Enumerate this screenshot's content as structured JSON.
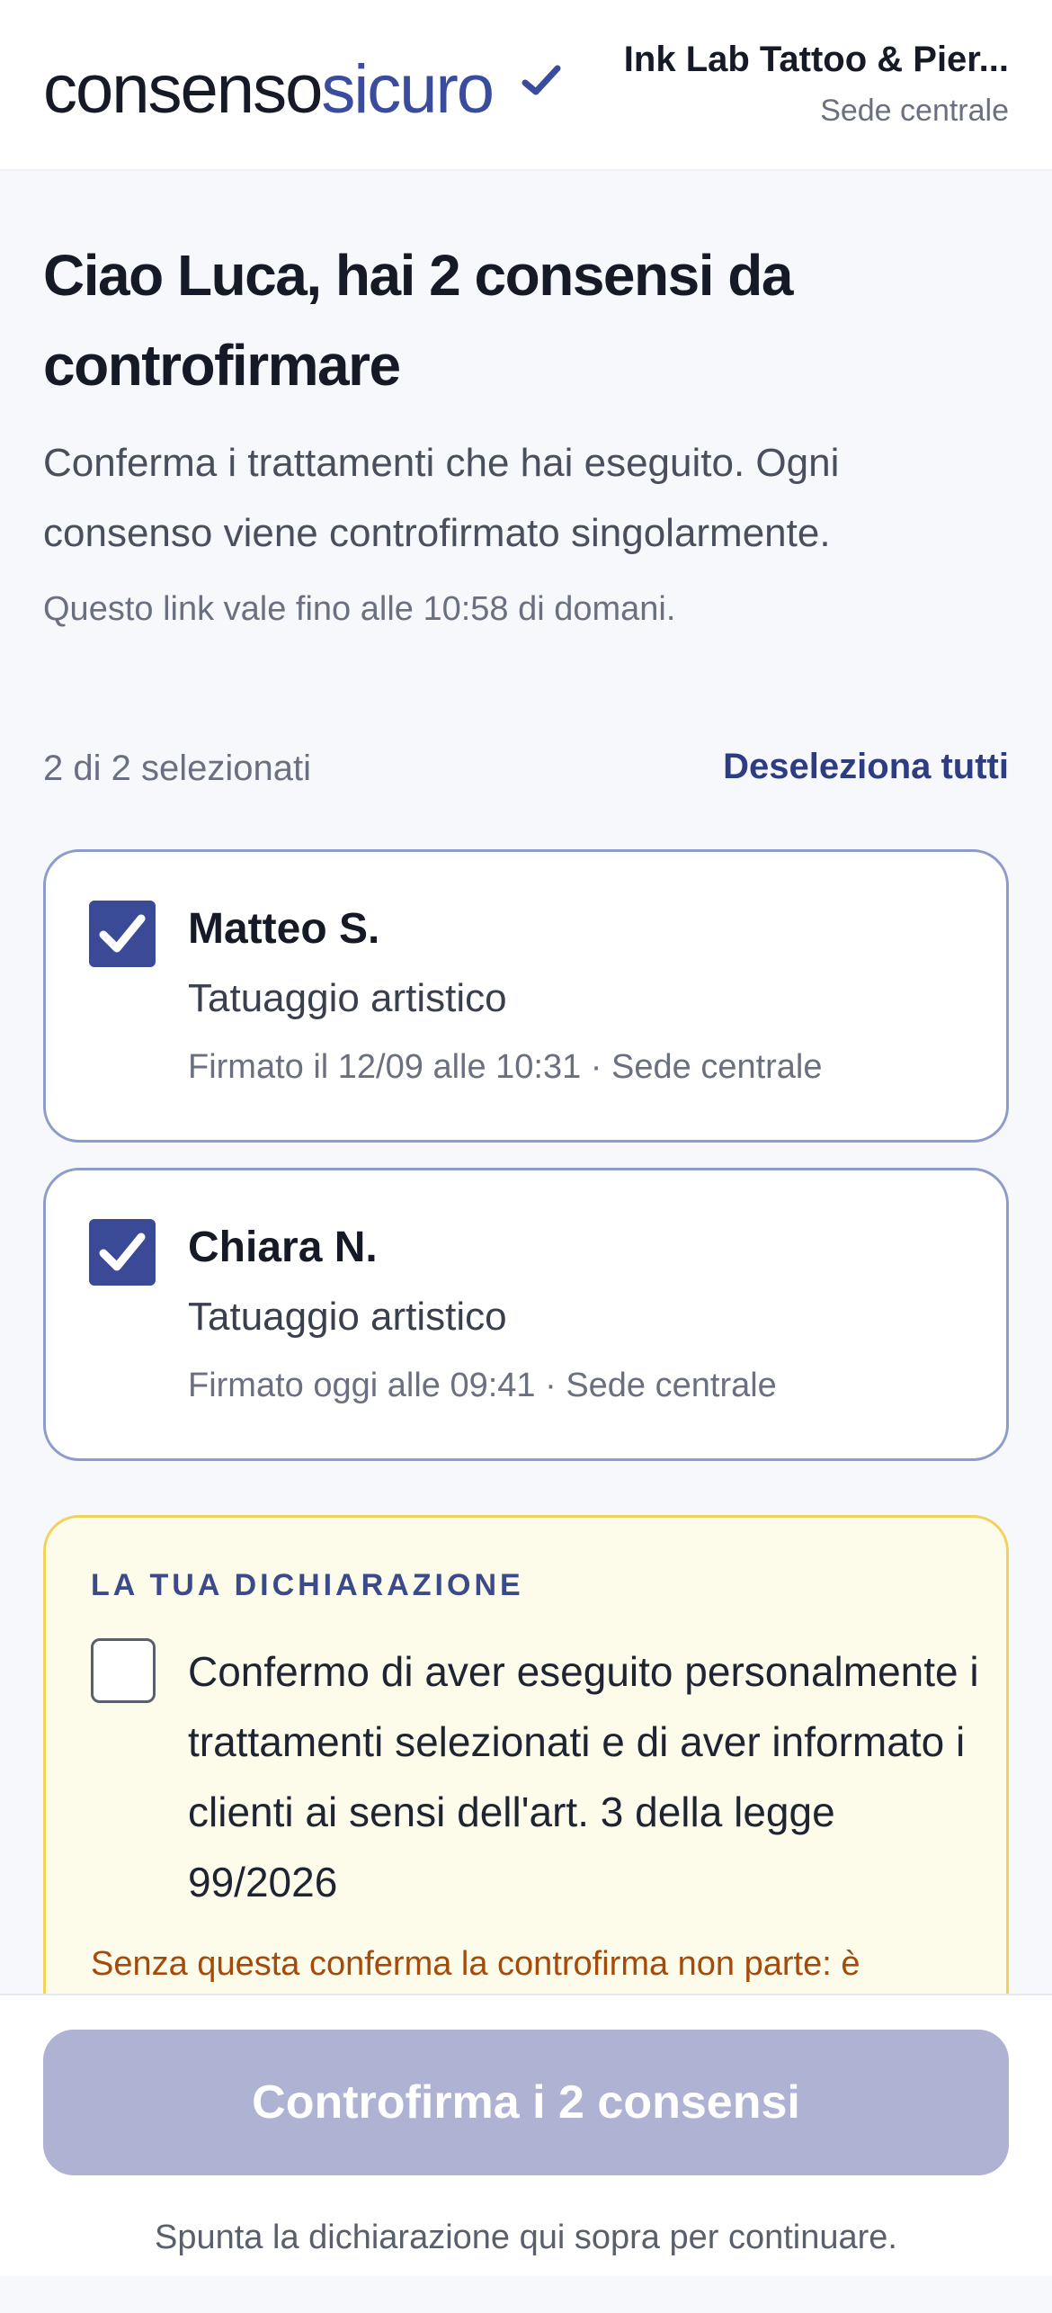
{
  "header": {
    "logo_part1": "consenso",
    "logo_part2": "sicuro",
    "business_name": "Ink Lab Tattoo & Pier...",
    "location": "Sede centrale"
  },
  "main": {
    "title": "Ciao Luca, hai 2 consensi da controfirmare",
    "intro": "Conferma i trattamenti che hai eseguito. Ogni consenso viene controfirmato singolarmente.",
    "expiry": "Questo link vale fino alle 10:58 di domani.",
    "selected_count": "2 di 2 selezionati",
    "deselect_all": "Deseleziona tutti"
  },
  "consents": [
    {
      "name": "Matteo S.",
      "treatment": "Tatuaggio artistico",
      "meta": "Firmato il 12/09 alle 10:31 · Sede centrale",
      "checked": true
    },
    {
      "name": "Chiara N.",
      "treatment": "Tatuaggio artistico",
      "meta": "Firmato oggi alle 09:41 · Sede centrale",
      "checked": true
    }
  ],
  "declaration": {
    "label": "LA TUA DICHIARAZIONE",
    "text": "Confermo di aver eseguito personalmente i trattamenti selezionati e di aver informato i clienti ai sensi dell'art. 3 della legge 99/2026",
    "warning": "Senza questa conferma la controfirma non parte: è",
    "checked": false
  },
  "footer": {
    "cta_label": "Controfirma i 2 consensi",
    "hint": "Spunta la dichiarazione qui sopra per continuare."
  },
  "colors": {
    "brand_blue": "#3a4c9e",
    "cta_disabled": "#aeb2d3",
    "warning_text": "#a64a0a",
    "declaration_bg": "#fdfbea"
  }
}
